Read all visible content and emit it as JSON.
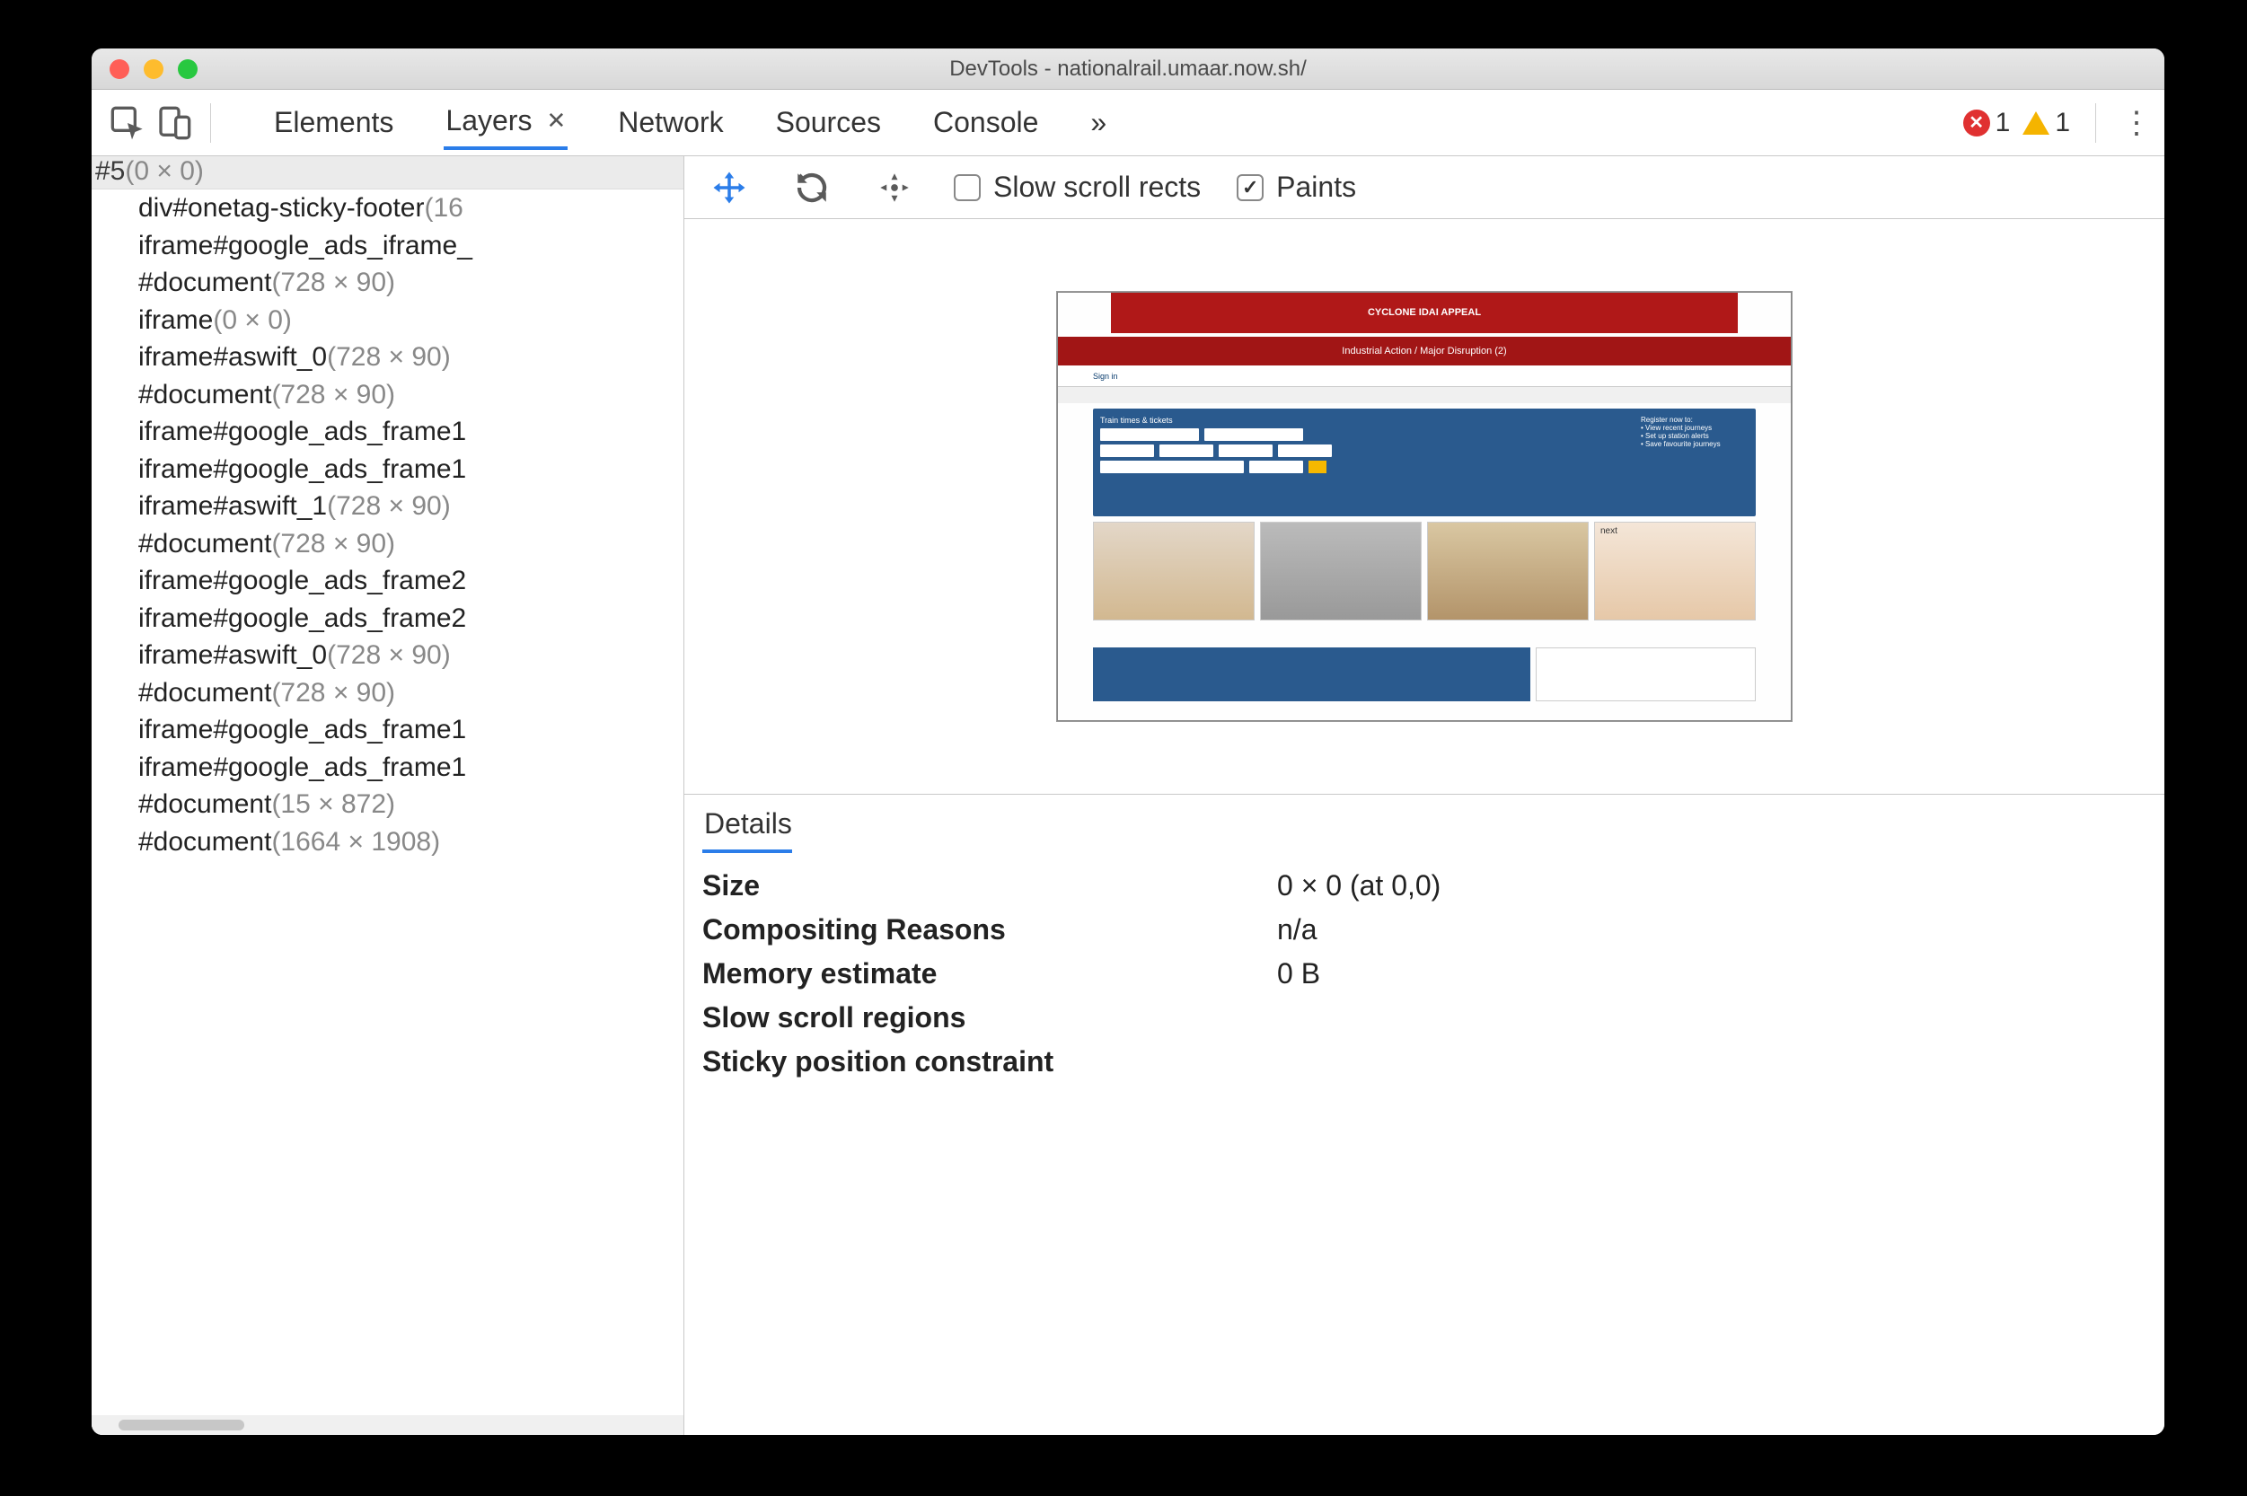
{
  "window": {
    "title": "DevTools - nationalrail.umaar.now.sh/"
  },
  "tabs": {
    "items": [
      "Elements",
      "Layers",
      "Network",
      "Sources",
      "Console"
    ],
    "active_index": 1,
    "overflow_glyph": "»"
  },
  "errors": {
    "error_count": "1",
    "warning_count": "1"
  },
  "tree": {
    "selected": {
      "label": "#5",
      "dim": "(0 × 0)"
    },
    "items": [
      {
        "label": "div#onetag-sticky-footer",
        "dim": "(16"
      },
      {
        "label": "iframe#google_ads_iframe_",
        "dim": ""
      },
      {
        "label": "#document",
        "dim": "(728 × 90)"
      },
      {
        "label": "iframe",
        "dim": "(0 × 0)"
      },
      {
        "label": "iframe#aswift_0",
        "dim": "(728 × 90)"
      },
      {
        "label": "#document",
        "dim": "(728 × 90)"
      },
      {
        "label": "iframe#google_ads_frame1",
        "dim": ""
      },
      {
        "label": "iframe#google_ads_frame1",
        "dim": ""
      },
      {
        "label": "iframe#aswift_1",
        "dim": "(728 × 90)"
      },
      {
        "label": "#document",
        "dim": "(728 × 90)"
      },
      {
        "label": "iframe#google_ads_frame2",
        "dim": ""
      },
      {
        "label": "iframe#google_ads_frame2",
        "dim": ""
      },
      {
        "label": "iframe#aswift_0",
        "dim": "(728 × 90)"
      },
      {
        "label": "#document",
        "dim": "(728 × 90)"
      },
      {
        "label": "iframe#google_ads_frame1",
        "dim": ""
      },
      {
        "label": "iframe#google_ads_frame1",
        "dim": ""
      },
      {
        "label": "#document",
        "dim": "(15 × 872)"
      },
      {
        "label": "#document",
        "dim": "(1664 × 1908)"
      }
    ]
  },
  "layers_toolbar": {
    "slow_scroll": {
      "label": "Slow scroll rects",
      "checked": false
    },
    "paints": {
      "label": "Paints",
      "checked": true
    }
  },
  "details": {
    "title": "Details",
    "rows": [
      {
        "k": "Size",
        "v": "0 × 0 (at 0,0)"
      },
      {
        "k": "Compositing Reasons",
        "v": "n/a"
      },
      {
        "k": "Memory estimate",
        "v": "0 B"
      },
      {
        "k": "Slow scroll regions",
        "v": ""
      },
      {
        "k": "Sticky position constraint",
        "v": ""
      }
    ]
  },
  "preview": {
    "banner": "CYCLONE IDAI APPEAL",
    "strip": "Industrial Action / Major Disruption (2)",
    "hero_title": "Train times & tickets"
  }
}
